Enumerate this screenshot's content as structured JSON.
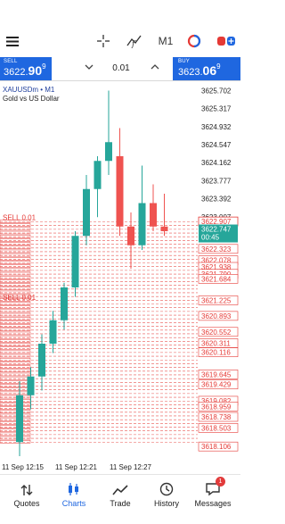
{
  "toolbar": {
    "timeframe": "M1",
    "menu_icon": "hamburger-menu-icon",
    "crosshair_icon": "crosshair-icon",
    "indicators_icon": "indicators-f-icon",
    "symbols_icon": "symbol-switch-icon",
    "trade_icon": "new-order-icon"
  },
  "trade_panel": {
    "sell_label": "SELL",
    "sell_price_main": "3622.",
    "sell_price_big": "90",
    "sell_price_sup": "9",
    "buy_label": "BUY",
    "buy_price_main": "3623.",
    "buy_price_big": "06",
    "buy_price_sup": "9",
    "volume": "0.01",
    "down_icon": "chevron-down-icon",
    "up_icon": "chevron-up-icon"
  },
  "chart_info": {
    "symbol": "XAUUSDm • M1",
    "description": "Gold vs US Dollar"
  },
  "chart_data": {
    "type": "candlestick",
    "ylim": [
      3617.9,
      3625.9
    ],
    "y_ticks": [
      {
        "v": 3625.702,
        "t": "3625.702"
      },
      {
        "v": 3625.317,
        "t": "3625.317"
      },
      {
        "v": 3624.932,
        "t": "3624.932"
      },
      {
        "v": 3624.547,
        "t": "3624.547"
      },
      {
        "v": 3624.162,
        "t": "3624.162"
      },
      {
        "v": 3623.777,
        "t": "3623.777"
      },
      {
        "v": 3623.392,
        "t": "3623.392"
      },
      {
        "v": 3623.007,
        "t": "3623.007"
      },
      {
        "v": 3622.323,
        "t": "3622.323"
      },
      {
        "v": 3622.078,
        "t": "3622.078"
      },
      {
        "v": 3621.938,
        "t": "3621.938"
      },
      {
        "v": 3621.79,
        "t": "3621.790"
      },
      {
        "v": 3621.684,
        "t": "3621.684"
      },
      {
        "v": 3621.225,
        "t": "3621.225"
      },
      {
        "v": 3620.893,
        "t": "3620.893"
      },
      {
        "v": 3620.552,
        "t": "3620.552"
      },
      {
        "v": 3620.311,
        "t": "3620.311"
      },
      {
        "v": 3620.116,
        "t": "3620.116"
      },
      {
        "v": 3619.645,
        "t": "3619.645"
      },
      {
        "v": 3619.429,
        "t": "3619.429"
      },
      {
        "v": 3619.082,
        "t": "3619.082"
      },
      {
        "v": 3618.959,
        "t": "3618.959"
      },
      {
        "v": 3618.738,
        "t": "3618.738"
      },
      {
        "v": 3618.503,
        "t": "3618.503"
      },
      {
        "v": 3618.106,
        "t": "3618.106"
      }
    ],
    "x_labels": [
      "11 Sep 12:15",
      "11 Sep 12:21",
      "11 Sep 12:27"
    ],
    "candles": [
      {
        "o": 3618.2,
        "h": 3619.5,
        "l": 3617.9,
        "c": 3619.2
      },
      {
        "o": 3619.2,
        "h": 3619.8,
        "l": 3618.9,
        "c": 3619.6
      },
      {
        "o": 3619.6,
        "h": 3620.5,
        "l": 3619.3,
        "c": 3620.3
      },
      {
        "o": 3620.3,
        "h": 3621.0,
        "l": 3620.1,
        "c": 3620.8
      },
      {
        "o": 3620.8,
        "h": 3621.6,
        "l": 3620.6,
        "c": 3621.5
      },
      {
        "o": 3621.5,
        "h": 3622.7,
        "l": 3621.3,
        "c": 3622.6
      },
      {
        "o": 3622.6,
        "h": 3623.9,
        "l": 3622.4,
        "c": 3623.6
      },
      {
        "o": 3623.6,
        "h": 3624.3,
        "l": 3623.0,
        "c": 3624.2
      },
      {
        "o": 3624.2,
        "h": 3625.7,
        "l": 3623.9,
        "c": 3624.6
      },
      {
        "o": 3624.3,
        "h": 3624.9,
        "l": 3622.6,
        "c": 3622.8
      },
      {
        "o": 3622.8,
        "h": 3623.1,
        "l": 3621.9,
        "c": 3622.4
      },
      {
        "o": 3622.4,
        "h": 3624.1,
        "l": 3622.3,
        "c": 3623.3
      },
      {
        "o": 3623.3,
        "h": 3623.7,
        "l": 3622.7,
        "c": 3622.8
      },
      {
        "o": 3622.8,
        "h": 3623.5,
        "l": 3622.6,
        "c": 3622.7
      }
    ],
    "sell_line": {
      "label": "SELL 0.01",
      "price": 3622.9
    },
    "sell_line_2": {
      "label": "SELL 0.01",
      "price": 3621.2
    },
    "current_price": {
      "price": "3622.747",
      "countdown": "00:45"
    },
    "bid_marker": "3622.907",
    "red_order_levels": 60
  },
  "nav": {
    "items": [
      {
        "label": "Quotes",
        "icon": "quotes-arrows-icon"
      },
      {
        "label": "Charts",
        "icon": "charts-candles-icon"
      },
      {
        "label": "Trade",
        "icon": "trade-line-icon"
      },
      {
        "label": "History",
        "icon": "history-clock-icon"
      },
      {
        "label": "Messages",
        "icon": "messages-chat-icon"
      }
    ],
    "messages_badge": "1"
  },
  "colors": {
    "accent": "#1f67e0",
    "bull": "#26a69a",
    "bear": "#ef5350",
    "order_red": "#e53935"
  }
}
